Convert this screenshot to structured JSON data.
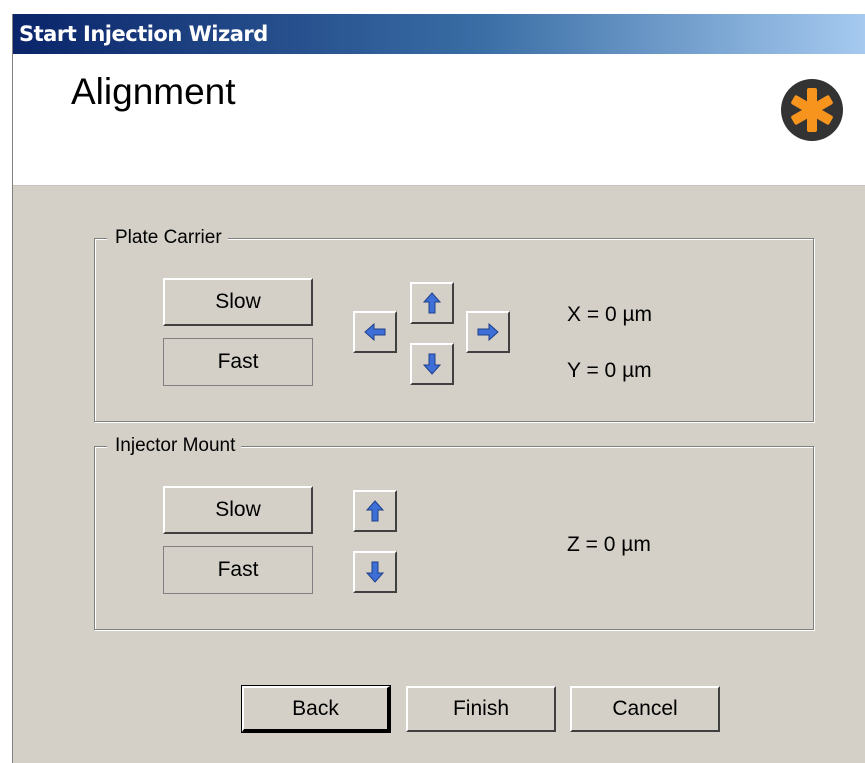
{
  "window": {
    "title": "Start Injection Wizard"
  },
  "header": {
    "title": "Alignment",
    "logo_icon": "orange-asterisk-icon",
    "logo_color": "#f7941d"
  },
  "plate_carrier": {
    "legend": "Plate Carrier",
    "slow_label": "Slow",
    "fast_label": "Fast",
    "arrows": [
      "arrow-up-icon",
      "arrow-left-icon",
      "arrow-right-icon",
      "arrow-down-icon"
    ],
    "x_readout": "X = 0 µm",
    "y_readout": "Y = 0 µm"
  },
  "injector_mount": {
    "legend": "Injector Mount",
    "slow_label": "Slow",
    "fast_label": "Fast",
    "arrows": [
      "arrow-up-icon",
      "arrow-down-icon"
    ],
    "z_readout": "Z = 0 µm"
  },
  "footer": {
    "back_label": "Back",
    "finish_label": "Finish",
    "cancel_label": "Cancel"
  },
  "colors": {
    "arrow_blue": "#3d6fd6",
    "title_gradient_start": "#0a246a",
    "title_gradient_end": "#a6caf0",
    "dialog_bg": "#d4d0c8"
  }
}
